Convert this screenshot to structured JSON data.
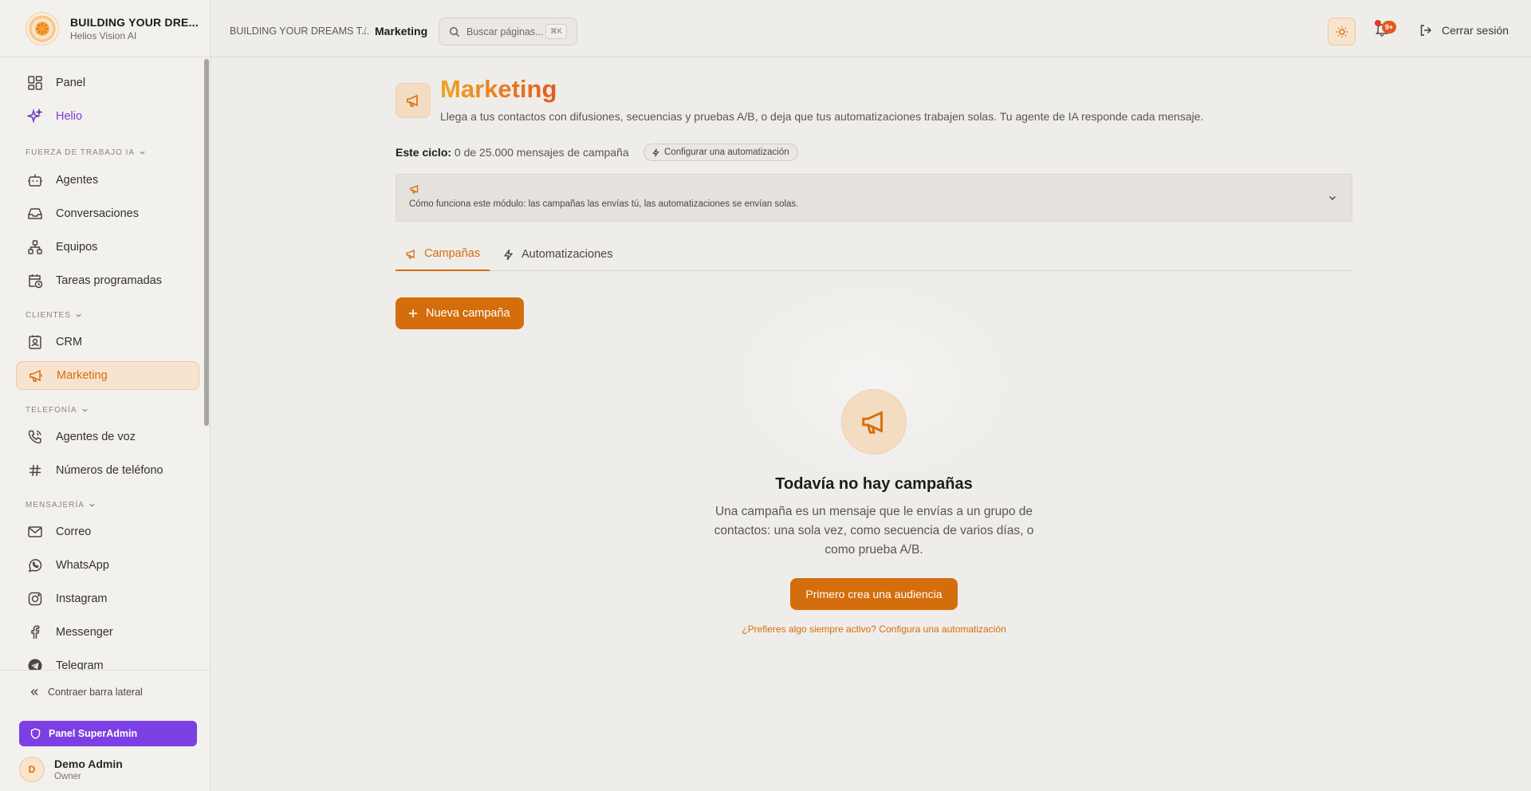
{
  "brand": {
    "name": "BUILDING YOUR DRE...",
    "subtitle": "Helios Vision AI"
  },
  "header": {
    "breadcrumb_parent": "BUILDING YOUR DREAMS T...",
    "breadcrumb_sep": "/",
    "breadcrumb_current": "Marketing",
    "search_placeholder": "Buscar páginas...",
    "search_shortcut": "⌘K",
    "notif_count": "9+",
    "logout_label": "Cerrar sesión"
  },
  "sidebar": {
    "items": {
      "panel": "Panel",
      "helio": "Helio",
      "agentes": "Agentes",
      "conversaciones": "Conversaciones",
      "equipos": "Equipos",
      "tareas": "Tareas programadas",
      "crm": "CRM",
      "marketing": "Marketing",
      "voz": "Agentes de voz",
      "numeros": "Números de teléfono",
      "correo": "Correo",
      "whatsapp": "WhatsApp",
      "instagram": "Instagram",
      "messenger": "Messenger",
      "telegram": "Telegram"
    },
    "sections": {
      "fuerza": "FUERZA DE TRABAJO IA",
      "clientes": "CLIENTES",
      "telefonia": "TELEFONÍA",
      "mensajeria": "MENSAJERÍA"
    },
    "collapse_label": "Contraer barra lateral",
    "superadmin_label": "Panel SuperAdmin",
    "user": {
      "initial": "D",
      "name": "Demo Admin",
      "role": "Owner"
    }
  },
  "main": {
    "title": "Marketing",
    "subtitle": "Llega a tus contactos con difusiones, secuencias y pruebas A/B, o deja que tus automatizaciones trabajen solas. Tu agente de IA responde cada mensaje.",
    "cycle_label": "Este ciclo:",
    "cycle_value": "0 de 25.000 mensajes de campaña",
    "configure_auto": "Configurar una automatización",
    "info_text": "Cómo funciona este módulo: las campañas las envías tú, las automatizaciones se envían solas.",
    "tabs": {
      "campaigns": "Campañas",
      "automations": "Automatizaciones"
    },
    "new_campaign": "Nueva campaña",
    "empty": {
      "title": "Todavía no hay campañas",
      "description": "Una campaña es un mensaje que le envías a un grupo de contactos: una sola vez, como secuencia de varios días, o como prueba A/B.",
      "cta": "Primero crea una audiencia",
      "alt_link": "¿Prefieres algo siempre activo? Configura una automatización"
    }
  },
  "colors": {
    "accent": "#d46d0c",
    "superadmin": "#7b3fe4",
    "helio": "#7a3fd6"
  },
  "icons": [
    "sun-icon",
    "bell-icon",
    "logout-icon",
    "search-icon",
    "megaphone-icon",
    "bolt-icon",
    "plus-icon",
    "chevron-down-icon"
  ]
}
